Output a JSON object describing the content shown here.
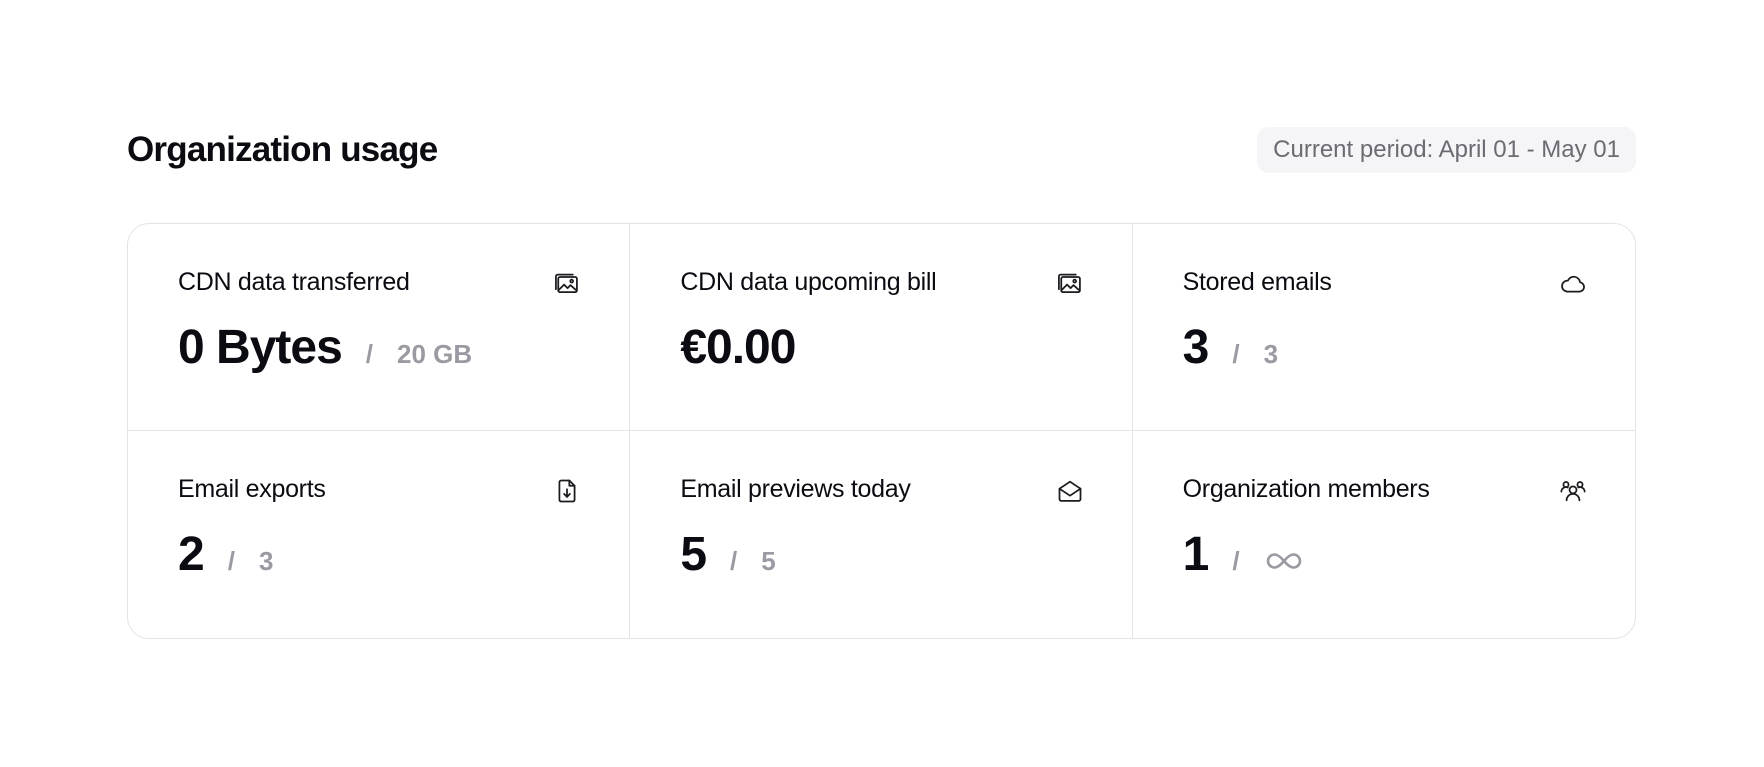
{
  "header": {
    "title": "Organization usage",
    "period": "Current period: April 01 - May 01"
  },
  "cards": [
    {
      "label": "CDN data transferred",
      "value": "0 Bytes",
      "separator": "/",
      "limit": "20 GB",
      "icon": "image-icon"
    },
    {
      "label": "CDN data upcoming bill",
      "value": "€0.00",
      "icon": "image-icon"
    },
    {
      "label": "Stored emails",
      "value": "3",
      "separator": "/",
      "limit": "3",
      "icon": "cloud-icon"
    },
    {
      "label": "Email exports",
      "value": "2",
      "separator": "/",
      "limit": "3",
      "icon": "file-download-icon"
    },
    {
      "label": "Email previews today",
      "value": "5",
      "separator": "/",
      "limit": "5",
      "icon": "mail-open-icon"
    },
    {
      "label": "Organization members",
      "value": "1",
      "separator": "/",
      "limit_icon": "infinity-icon",
      "icon": "users-icon"
    }
  ]
}
